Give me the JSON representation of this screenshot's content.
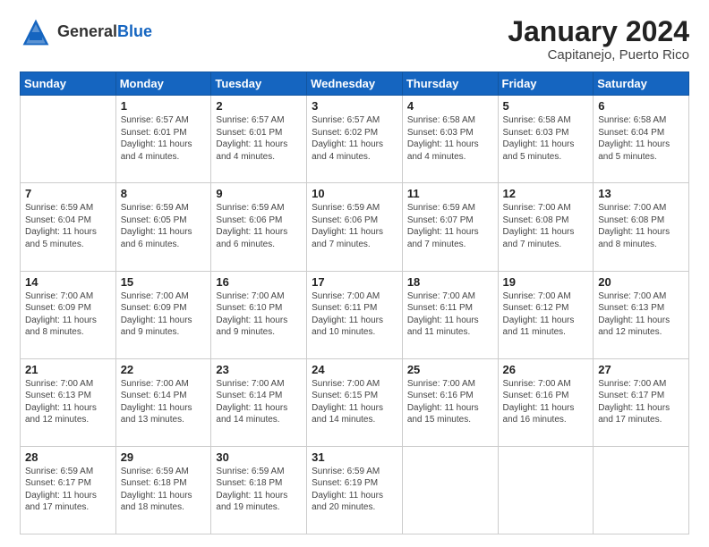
{
  "header": {
    "logo_general": "General",
    "logo_blue": "Blue",
    "month_title": "January 2024",
    "subtitle": "Capitanejo, Puerto Rico"
  },
  "weekdays": [
    "Sunday",
    "Monday",
    "Tuesday",
    "Wednesday",
    "Thursday",
    "Friday",
    "Saturday"
  ],
  "weeks": [
    [
      {
        "day": "",
        "info": ""
      },
      {
        "day": "1",
        "info": "Sunrise: 6:57 AM\nSunset: 6:01 PM\nDaylight: 11 hours\nand 4 minutes."
      },
      {
        "day": "2",
        "info": "Sunrise: 6:57 AM\nSunset: 6:01 PM\nDaylight: 11 hours\nand 4 minutes."
      },
      {
        "day": "3",
        "info": "Sunrise: 6:57 AM\nSunset: 6:02 PM\nDaylight: 11 hours\nand 4 minutes."
      },
      {
        "day": "4",
        "info": "Sunrise: 6:58 AM\nSunset: 6:03 PM\nDaylight: 11 hours\nand 4 minutes."
      },
      {
        "day": "5",
        "info": "Sunrise: 6:58 AM\nSunset: 6:03 PM\nDaylight: 11 hours\nand 5 minutes."
      },
      {
        "day": "6",
        "info": "Sunrise: 6:58 AM\nSunset: 6:04 PM\nDaylight: 11 hours\nand 5 minutes."
      }
    ],
    [
      {
        "day": "7",
        "info": "Sunrise: 6:59 AM\nSunset: 6:04 PM\nDaylight: 11 hours\nand 5 minutes."
      },
      {
        "day": "8",
        "info": "Sunrise: 6:59 AM\nSunset: 6:05 PM\nDaylight: 11 hours\nand 6 minutes."
      },
      {
        "day": "9",
        "info": "Sunrise: 6:59 AM\nSunset: 6:06 PM\nDaylight: 11 hours\nand 6 minutes."
      },
      {
        "day": "10",
        "info": "Sunrise: 6:59 AM\nSunset: 6:06 PM\nDaylight: 11 hours\nand 7 minutes."
      },
      {
        "day": "11",
        "info": "Sunrise: 6:59 AM\nSunset: 6:07 PM\nDaylight: 11 hours\nand 7 minutes."
      },
      {
        "day": "12",
        "info": "Sunrise: 7:00 AM\nSunset: 6:08 PM\nDaylight: 11 hours\nand 7 minutes."
      },
      {
        "day": "13",
        "info": "Sunrise: 7:00 AM\nSunset: 6:08 PM\nDaylight: 11 hours\nand 8 minutes."
      }
    ],
    [
      {
        "day": "14",
        "info": "Sunrise: 7:00 AM\nSunset: 6:09 PM\nDaylight: 11 hours\nand 8 minutes."
      },
      {
        "day": "15",
        "info": "Sunrise: 7:00 AM\nSunset: 6:09 PM\nDaylight: 11 hours\nand 9 minutes."
      },
      {
        "day": "16",
        "info": "Sunrise: 7:00 AM\nSunset: 6:10 PM\nDaylight: 11 hours\nand 9 minutes."
      },
      {
        "day": "17",
        "info": "Sunrise: 7:00 AM\nSunset: 6:11 PM\nDaylight: 11 hours\nand 10 minutes."
      },
      {
        "day": "18",
        "info": "Sunrise: 7:00 AM\nSunset: 6:11 PM\nDaylight: 11 hours\nand 11 minutes."
      },
      {
        "day": "19",
        "info": "Sunrise: 7:00 AM\nSunset: 6:12 PM\nDaylight: 11 hours\nand 11 minutes."
      },
      {
        "day": "20",
        "info": "Sunrise: 7:00 AM\nSunset: 6:13 PM\nDaylight: 11 hours\nand 12 minutes."
      }
    ],
    [
      {
        "day": "21",
        "info": "Sunrise: 7:00 AM\nSunset: 6:13 PM\nDaylight: 11 hours\nand 12 minutes."
      },
      {
        "day": "22",
        "info": "Sunrise: 7:00 AM\nSunset: 6:14 PM\nDaylight: 11 hours\nand 13 minutes."
      },
      {
        "day": "23",
        "info": "Sunrise: 7:00 AM\nSunset: 6:14 PM\nDaylight: 11 hours\nand 14 minutes."
      },
      {
        "day": "24",
        "info": "Sunrise: 7:00 AM\nSunset: 6:15 PM\nDaylight: 11 hours\nand 14 minutes."
      },
      {
        "day": "25",
        "info": "Sunrise: 7:00 AM\nSunset: 6:16 PM\nDaylight: 11 hours\nand 15 minutes."
      },
      {
        "day": "26",
        "info": "Sunrise: 7:00 AM\nSunset: 6:16 PM\nDaylight: 11 hours\nand 16 minutes."
      },
      {
        "day": "27",
        "info": "Sunrise: 7:00 AM\nSunset: 6:17 PM\nDaylight: 11 hours\nand 17 minutes."
      }
    ],
    [
      {
        "day": "28",
        "info": "Sunrise: 6:59 AM\nSunset: 6:17 PM\nDaylight: 11 hours\nand 17 minutes."
      },
      {
        "day": "29",
        "info": "Sunrise: 6:59 AM\nSunset: 6:18 PM\nDaylight: 11 hours\nand 18 minutes."
      },
      {
        "day": "30",
        "info": "Sunrise: 6:59 AM\nSunset: 6:18 PM\nDaylight: 11 hours\nand 19 minutes."
      },
      {
        "day": "31",
        "info": "Sunrise: 6:59 AM\nSunset: 6:19 PM\nDaylight: 11 hours\nand 20 minutes."
      },
      {
        "day": "",
        "info": ""
      },
      {
        "day": "",
        "info": ""
      },
      {
        "day": "",
        "info": ""
      }
    ]
  ]
}
